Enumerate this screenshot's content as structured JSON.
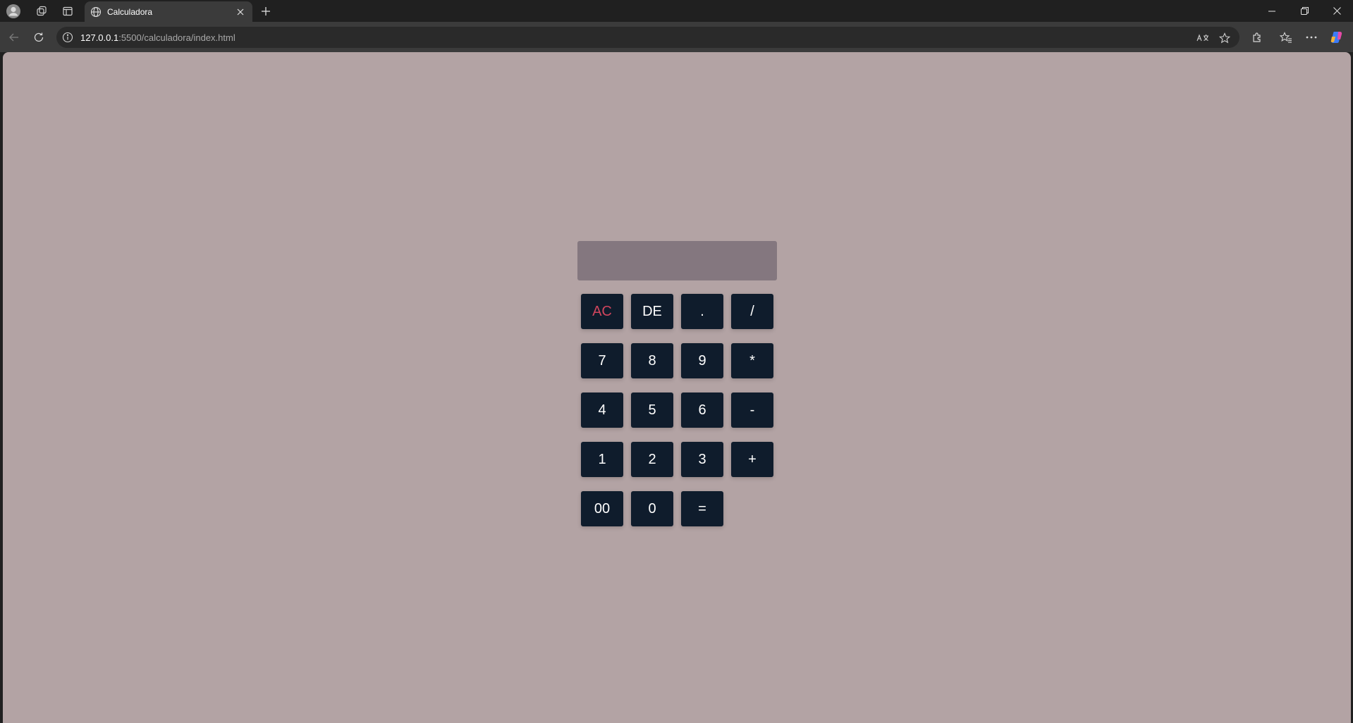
{
  "browser": {
    "tab_title": "Calculadora",
    "url_host": "127.0.0.1",
    "url_rest": ":5500/calculadora/index.html",
    "icons": [
      "profile-icon",
      "workspaces-icon",
      "tab-actions-icon",
      "globe-icon",
      "close-icon",
      "plus-icon",
      "minimize-icon",
      "restore-icon",
      "window-close-icon",
      "back-icon",
      "refresh-icon",
      "info-icon",
      "read-aloud-icon",
      "favorite-star-icon",
      "extensions-icon",
      "favorites-icon",
      "more-icon",
      "copilot-icon"
    ]
  },
  "calculator": {
    "display_value": "",
    "keys": [
      {
        "label": "AC",
        "type": "clear"
      },
      {
        "label": "DE",
        "type": "delete"
      },
      {
        "label": ".",
        "type": "digit"
      },
      {
        "label": "/",
        "type": "operator"
      },
      {
        "label": "7",
        "type": "digit"
      },
      {
        "label": "8",
        "type": "digit"
      },
      {
        "label": "9",
        "type": "digit"
      },
      {
        "label": "*",
        "type": "operator"
      },
      {
        "label": "4",
        "type": "digit"
      },
      {
        "label": "5",
        "type": "digit"
      },
      {
        "label": "6",
        "type": "digit"
      },
      {
        "label": "-",
        "type": "operator"
      },
      {
        "label": "1",
        "type": "digit"
      },
      {
        "label": "2",
        "type": "digit"
      },
      {
        "label": "3",
        "type": "digit"
      },
      {
        "label": "+",
        "type": "operator"
      },
      {
        "label": "00",
        "type": "digit"
      },
      {
        "label": "0",
        "type": "digit"
      },
      {
        "label": "=",
        "type": "equals"
      }
    ]
  },
  "colors": {
    "page_background": "#b3a3a4",
    "display_background": "#84777f",
    "key_background": "#0f1c2c",
    "key_text": "#ffffff",
    "clear_text": "#d0455d"
  }
}
